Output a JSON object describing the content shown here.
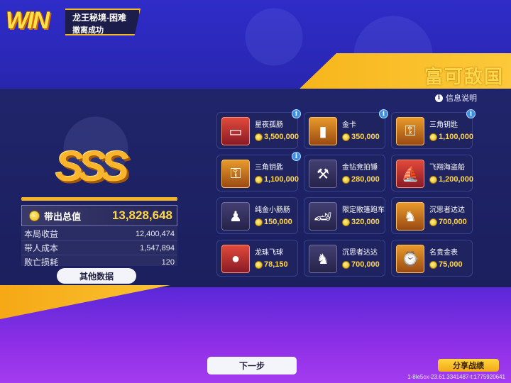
{
  "header": {
    "logo_text": "WIN",
    "dungeon_title": "龙王秘境-困难",
    "evac_status": "撤离成功"
  },
  "rank": {
    "title": "富可敌国",
    "info_link": "信息说明",
    "grade": "SSS"
  },
  "summary": {
    "total_label": "带出总值",
    "total_value": "13,828,648",
    "rows": [
      {
        "label": "本局收益",
        "value": "12,400,474"
      },
      {
        "label": "带人成本",
        "value": "1,547,894"
      },
      {
        "label": "败亡损耗",
        "value": "120"
      }
    ]
  },
  "other_data_button": "其他数据",
  "loot": [
    {
      "name": "星夜孤肠",
      "value": "3,500,000",
      "tier": "red",
      "icon": "star-card-icon",
      "glyph": "▭",
      "badge": true
    },
    {
      "name": "金卡",
      "value": "350,000",
      "tier": "gold",
      "icon": "gold-card-icon",
      "glyph": "▮",
      "badge": true
    },
    {
      "name": "三角钥匙",
      "value": "1,100,000",
      "tier": "gold",
      "icon": "triangle-key-icon",
      "glyph": "⚿",
      "badge": true
    },
    {
      "name": "三角钥匙",
      "value": "1,100,000",
      "tier": "gold",
      "icon": "triangle-key-icon",
      "glyph": "⚿",
      "badge": true
    },
    {
      "name": "金钻竞拍锤",
      "value": "280,000",
      "tier": "purple",
      "icon": "auction-hammer-icon",
      "glyph": "⚒",
      "badge": false
    },
    {
      "name": "飞翔海盗船",
      "value": "1,200,000",
      "tier": "red",
      "icon": "pirate-ship-icon",
      "glyph": "⛵",
      "badge": false
    },
    {
      "name": "纯金小肠肠",
      "value": "150,000",
      "tier": "purple",
      "icon": "gold-figure-icon",
      "glyph": "♟",
      "badge": false
    },
    {
      "name": "限定敞篷跑车",
      "value": "320,000",
      "tier": "purple",
      "icon": "sports-car-icon",
      "glyph": "🏎",
      "badge": false
    },
    {
      "name": "沉思者达达",
      "value": "700,000",
      "tier": "gold",
      "icon": "thinker-statue-icon",
      "glyph": "♞",
      "badge": false
    },
    {
      "name": "龙珠飞球",
      "value": "78,150",
      "tier": "red",
      "icon": "dragon-ball-icon",
      "glyph": "●",
      "badge": false
    },
    {
      "name": "沉思者达达",
      "value": "700,000",
      "tier": "purple",
      "icon": "thinker-statue-icon",
      "glyph": "♞",
      "badge": false
    },
    {
      "name": "名贵金表",
      "value": "75,000",
      "tier": "gold",
      "icon": "gold-watch-icon",
      "glyph": "⌚",
      "badge": false
    }
  ],
  "footer": {
    "next_button": "下一步",
    "share_button": "分享战绩",
    "session_id": "1-8le5cx-23.61.3341487-t:1775920641"
  }
}
